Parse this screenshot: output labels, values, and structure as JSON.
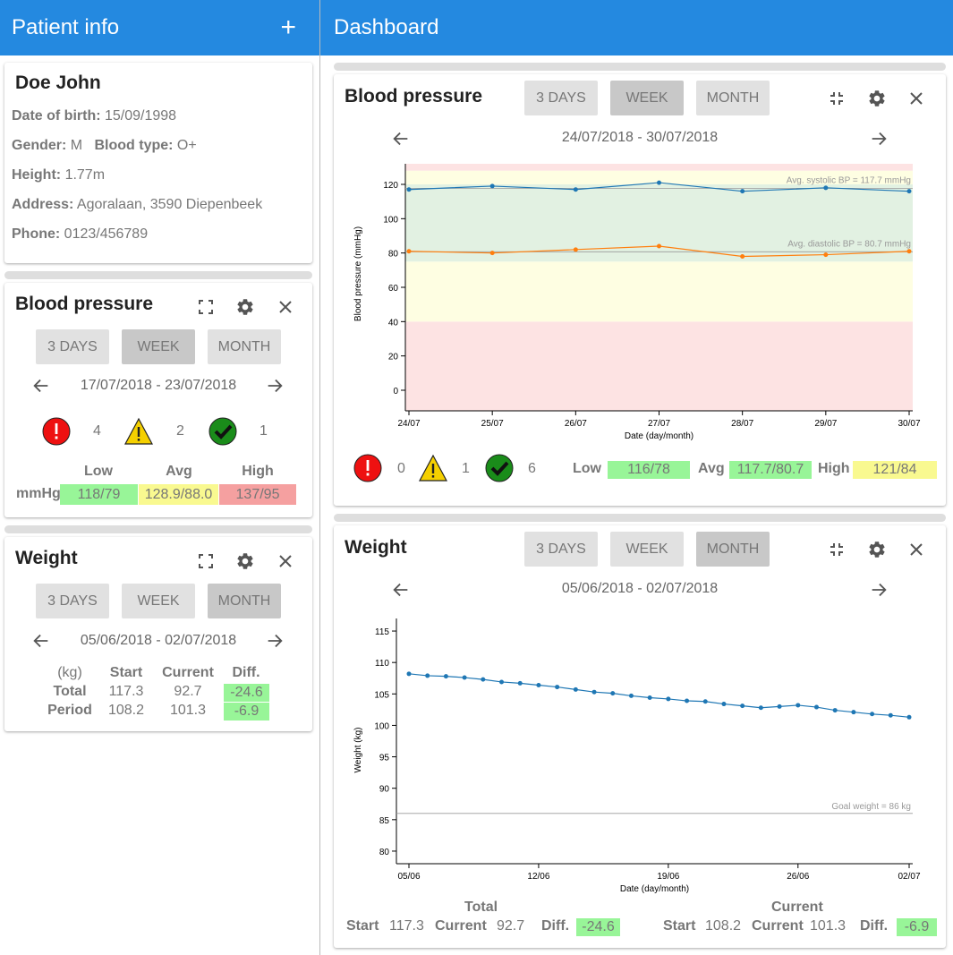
{
  "header": {
    "left_title": "Patient info",
    "add_label": "+",
    "right_title": "Dashboard"
  },
  "patient": {
    "name": "Doe John",
    "dob_label": "Date of birth:",
    "dob": "15/09/1998",
    "gender_label": "Gender:",
    "gender": "M",
    "blood_type_label": "Blood type:",
    "blood_type": "O+",
    "height_label": "Height:",
    "height": "1.77m",
    "address_label": "Address:",
    "address": "Agoralaan, 3590 Diepenbeek",
    "phone_label": "Phone:",
    "phone": "0123/456789"
  },
  "periods": [
    "3 DAYS",
    "WEEK",
    "MONTH"
  ],
  "bp_small": {
    "title": "Blood pressure",
    "active_period": "WEEK",
    "range": "17/07/2018 - 23/07/2018",
    "counts": {
      "alert": "4",
      "warning": "2",
      "ok": "1"
    },
    "table": {
      "headers": [
        "Low",
        "Avg",
        "High"
      ],
      "unit": "mmHg",
      "low": "118/79",
      "avg": "128.9/88.0",
      "high": "137/95"
    }
  },
  "weight_small": {
    "title": "Weight",
    "active_period": "MONTH",
    "range": "05/06/2018 - 02/07/2018",
    "table": {
      "headers": [
        "(kg)",
        "Start",
        "Current",
        "Diff."
      ],
      "rows": [
        {
          "label": "Total",
          "start": "117.3",
          "current": "92.7",
          "diff": "-24.6"
        },
        {
          "label": "Period",
          "start": "108.2",
          "current": "101.3",
          "diff": "-6.9"
        }
      ]
    }
  },
  "bp_large": {
    "title": "Blood pressure",
    "active_period": "WEEK",
    "range": "24/07/2018 - 30/07/2018",
    "counts": {
      "alert": "0",
      "warning": "1",
      "ok": "6"
    },
    "low_label": "Low",
    "low": "116/78",
    "avg_label": "Avg",
    "avg": "117.7/80.7",
    "high_label": "High",
    "high": "121/84"
  },
  "weight_large": {
    "title": "Weight",
    "active_period": "MONTH",
    "range": "05/06/2018 - 02/07/2018",
    "total": {
      "heading": "Total",
      "start_label": "Start",
      "start": "117.3",
      "current_label": "Current",
      "current": "92.7",
      "diff_label": "Diff.",
      "diff": "-24.6"
    },
    "current": {
      "heading": "Current",
      "start_label": "Start",
      "start": "108.2",
      "current_label": "Current",
      "current": "101.3",
      "diff_label": "Diff.",
      "diff": "-6.9"
    }
  },
  "colors": {
    "accent": "#2489e0",
    "systolic": "#1f77b4",
    "diastolic": "#ff7f0e",
    "good": "#98f598",
    "warn": "#f9f990",
    "bad": "#f5a0a0"
  },
  "chart_data": [
    {
      "type": "line",
      "title": "",
      "xlabel": "Date (day/month)",
      "ylabel": "Blood pressure (mmHg)",
      "categories": [
        "24/07",
        "25/07",
        "26/07",
        "27/07",
        "28/07",
        "29/07",
        "30/07"
      ],
      "series": [
        {
          "name": "systolic",
          "values": [
            117,
            119,
            117,
            121,
            116,
            118,
            116
          ]
        },
        {
          "name": "diastolic",
          "values": [
            81,
            80,
            82,
            84,
            78,
            79,
            81
          ]
        }
      ],
      "ylim": [
        -12,
        132
      ],
      "yticks": [
        0,
        20,
        40,
        60,
        80,
        100,
        120
      ],
      "bands": [
        {
          "from": -12,
          "to": 40,
          "color": "#fde3e3"
        },
        {
          "from": 40,
          "to": 75,
          "color": "#fefee2"
        },
        {
          "from": 75,
          "to": 120,
          "color": "#e2f1e2"
        },
        {
          "from": 120,
          "to": 128,
          "color": "#fefee2"
        },
        {
          "from": 128,
          "to": 132,
          "color": "#fde3e3"
        }
      ],
      "annotations": [
        {
          "text": "Avg. systolic BP = 117.7 mmHg",
          "y": 117.7
        },
        {
          "text": "Avg. diastolic BP = 80.7 mmHg",
          "y": 80.7
        }
      ]
    },
    {
      "type": "line",
      "title": "",
      "xlabel": "Date (day/month)",
      "ylabel": "Weight (kg)",
      "x_start": "05/06",
      "x_end": "02/07",
      "xticks": [
        "05/06",
        "12/06",
        "19/06",
        "26/06",
        "02/07"
      ],
      "values": [
        108.2,
        107.9,
        107.8,
        107.6,
        107.3,
        106.9,
        106.7,
        106.4,
        106.1,
        105.7,
        105.3,
        105.1,
        104.7,
        104.4,
        104.2,
        103.9,
        103.8,
        103.4,
        103.1,
        102.8,
        103.0,
        103.2,
        102.9,
        102.4,
        102.1,
        101.8,
        101.6,
        101.3
      ],
      "ylim": [
        78,
        117
      ],
      "yticks": [
        80,
        85,
        90,
        95,
        100,
        105,
        110,
        115
      ],
      "annotations": [
        {
          "text": "Goal weight = 86 kg",
          "y": 86
        }
      ]
    }
  ]
}
